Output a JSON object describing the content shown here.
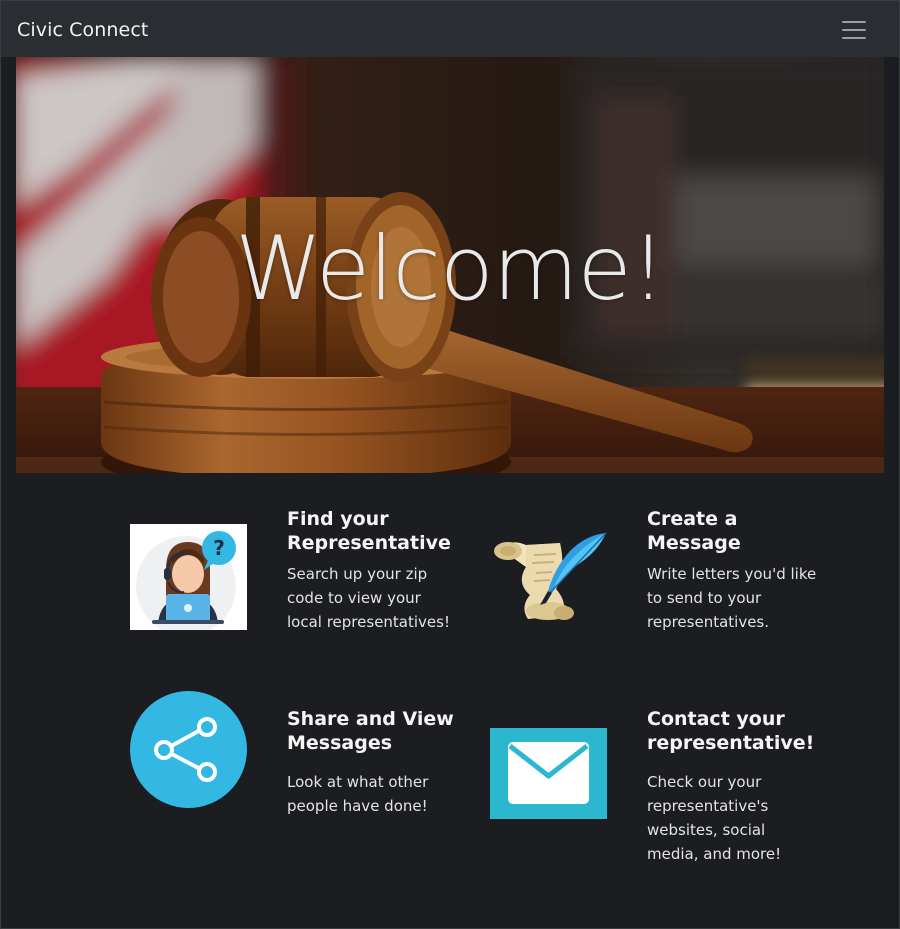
{
  "navbar": {
    "brand": "Civic Connect",
    "menu_icon": "hamburger-menu-icon"
  },
  "hero": {
    "title": "Welcome!",
    "image": "gavel-and-flag-photo"
  },
  "features": [
    {
      "icon": "support-agent-question-icon",
      "title": "Find your Representative",
      "text": "Search up your zip code to view your local representatives!"
    },
    {
      "icon": "scroll-and-quill-icon",
      "title": "Create a Message",
      "text": "Write letters you'd like to send to your representatives."
    },
    {
      "icon": "share-icon",
      "title": "Share and View Messages",
      "text": "Look at what other people have done!"
    },
    {
      "icon": "envelope-icon",
      "title": "Contact your representative!",
      "text": "Check our your representative's websites, social media, and more!"
    }
  ],
  "colors": {
    "navbar_bg": "#2a2d31",
    "page_bg": "#1b1d20",
    "share_blue": "#33b8e3",
    "mail_teal": "#2bb7cd"
  }
}
